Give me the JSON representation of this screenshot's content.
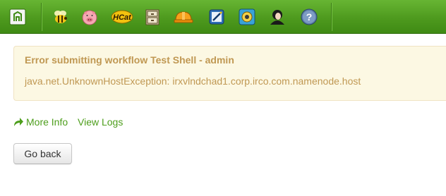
{
  "nav": {
    "icons": [
      "hue-home-icon",
      "beeswax-bee-icon",
      "pig-icon",
      "hcat-icon",
      "file-browser-icon",
      "job-designer-hardhat-icon",
      "oozie-editor-icon",
      "job-browser-icon",
      "user-admin-icon",
      "help-icon"
    ],
    "hcat_label": "HCat"
  },
  "alert": {
    "title": "Error submitting workflow Test Shell - admin",
    "message": "java.net.UnknownHostException: irxvlndchad1.corp.irco.com.namenode.host"
  },
  "links": {
    "more_info": "More Info",
    "view_logs": "View Logs"
  },
  "buttons": {
    "go_back": "Go back"
  },
  "colors": {
    "nav_green": "#4e9a1e",
    "alert_bg": "#fcf8e3",
    "alert_text": "#c09853",
    "link_green": "#4d9e1c"
  }
}
